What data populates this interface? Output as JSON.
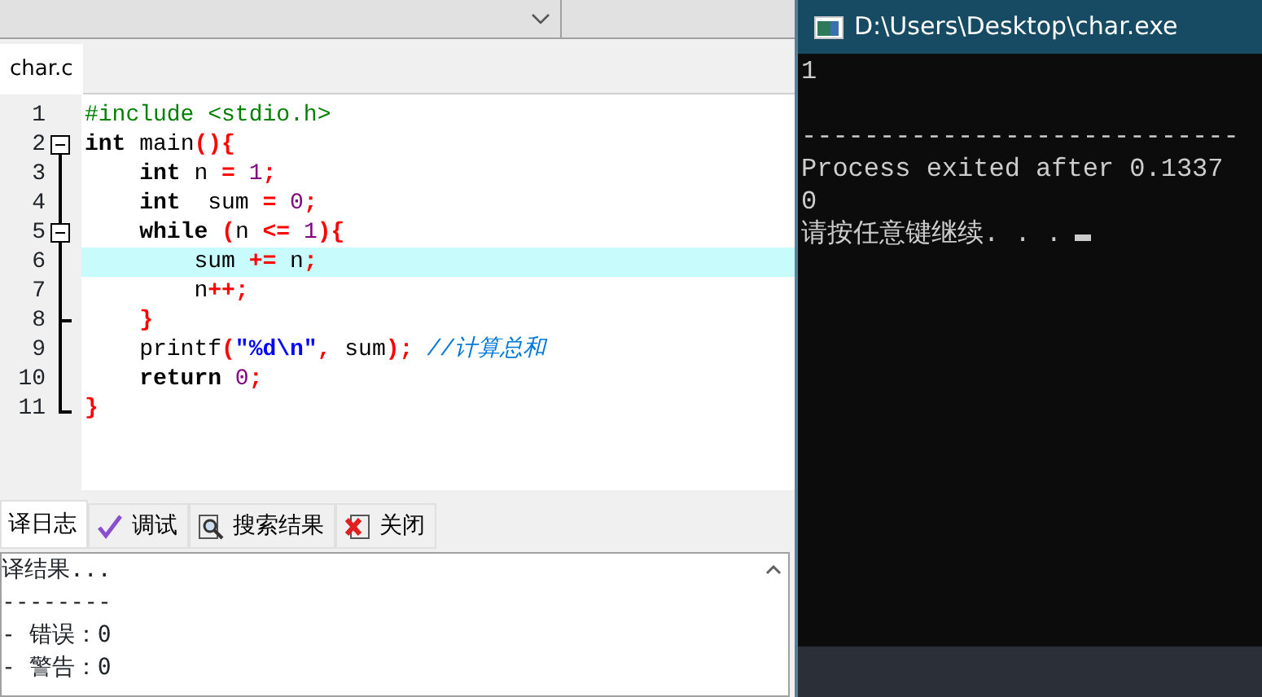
{
  "editor_tabs": [
    {
      "label": "char.c",
      "selected": true
    }
  ],
  "code_lines": [
    {
      "number": "1",
      "kind": "plain",
      "highlighted": false,
      "tokens": [
        {
          "kind": "pp",
          "text": "#include <stdio.h>"
        }
      ]
    },
    {
      "number": "2",
      "kind": "block_start",
      "highlighted": false,
      "tokens": [
        {
          "kind": "kw",
          "text": "int"
        },
        {
          "kind": "id",
          "text": " main"
        },
        {
          "kind": "op",
          "text": "(){"
        }
      ]
    },
    {
      "number": "3",
      "kind": "block_body",
      "highlighted": false,
      "tokens": [
        {
          "kind": "kw",
          "text": "    int"
        },
        {
          "kind": "id",
          "text": " n "
        },
        {
          "kind": "op",
          "text": "="
        },
        {
          "kind": "num",
          "text": " 1"
        },
        {
          "kind": "op",
          "text": ";"
        }
      ]
    },
    {
      "number": "4",
      "kind": "block_body",
      "highlighted": false,
      "tokens": [
        {
          "kind": "kw",
          "text": "    int"
        },
        {
          "kind": "id",
          "text": "  sum "
        },
        {
          "kind": "op",
          "text": "="
        },
        {
          "kind": "num",
          "text": " 0"
        },
        {
          "kind": "op",
          "text": ";"
        }
      ]
    },
    {
      "number": "5",
      "kind": "inner_block_start",
      "highlighted": false,
      "tokens": [
        {
          "kind": "kw",
          "text": "    while"
        },
        {
          "kind": "op",
          "text": " ("
        },
        {
          "kind": "id",
          "text": "n "
        },
        {
          "kind": "op",
          "text": "<="
        },
        {
          "kind": "num",
          "text": " 1"
        },
        {
          "kind": "op",
          "text": "){"
        }
      ]
    },
    {
      "number": "6",
      "kind": "block_body",
      "highlighted": true,
      "tokens": [
        {
          "kind": "id",
          "text": "        sum "
        },
        {
          "kind": "op",
          "text": "+="
        },
        {
          "kind": "id",
          "text": " n"
        },
        {
          "kind": "op",
          "text": ";"
        }
      ]
    },
    {
      "number": "7",
      "kind": "block_body",
      "highlighted": false,
      "tokens": [
        {
          "kind": "id",
          "text": "        n"
        },
        {
          "kind": "op",
          "text": "++;"
        }
      ]
    },
    {
      "number": "8",
      "kind": "inner_block_end",
      "highlighted": false,
      "tokens": [
        {
          "kind": "op",
          "text": "    }"
        }
      ]
    },
    {
      "number": "9",
      "kind": "block_body",
      "highlighted": false,
      "tokens": [
        {
          "kind": "id",
          "text": "    printf"
        },
        {
          "kind": "op",
          "text": "("
        },
        {
          "kind": "str",
          "text": "\"%d\\n\""
        },
        {
          "kind": "op",
          "text": ","
        },
        {
          "kind": "id",
          "text": " sum"
        },
        {
          "kind": "op",
          "text": ");"
        },
        {
          "kind": "cm",
          "text": " //计算总和"
        }
      ]
    },
    {
      "number": "10",
      "kind": "block_body",
      "highlighted": false,
      "tokens": [
        {
          "kind": "kw",
          "text": "    return"
        },
        {
          "kind": "num",
          "text": " 0"
        },
        {
          "kind": "op",
          "text": ";"
        }
      ]
    },
    {
      "number": "11",
      "kind": "block_end",
      "highlighted": false,
      "tokens": [
        {
          "kind": "op",
          "text": "}"
        }
      ]
    }
  ],
  "bottom_tabs": [
    {
      "label": "译日志",
      "selected": true
    },
    {
      "label": "调试",
      "selected": false
    },
    {
      "label": "搜索结果",
      "selected": false
    },
    {
      "label": "关闭",
      "selected": false
    }
  ],
  "log_lines": [
    "译结果...",
    "--------",
    "- 错误：0",
    "- 警告：0"
  ],
  "console": {
    "title": "D:\\Users\\Desktop\\char.exe",
    "cursor": true,
    "lines": [
      {
        "kind": "output",
        "text": "1"
      },
      {
        "kind": "separator",
        "text": "----------------------------"
      },
      {
        "kind": "output",
        "text": "Process exited after 0.1337"
      },
      {
        "kind": "output",
        "text": "0"
      },
      {
        "kind": "output",
        "text": "请按任意键继续. . ."
      }
    ]
  }
}
